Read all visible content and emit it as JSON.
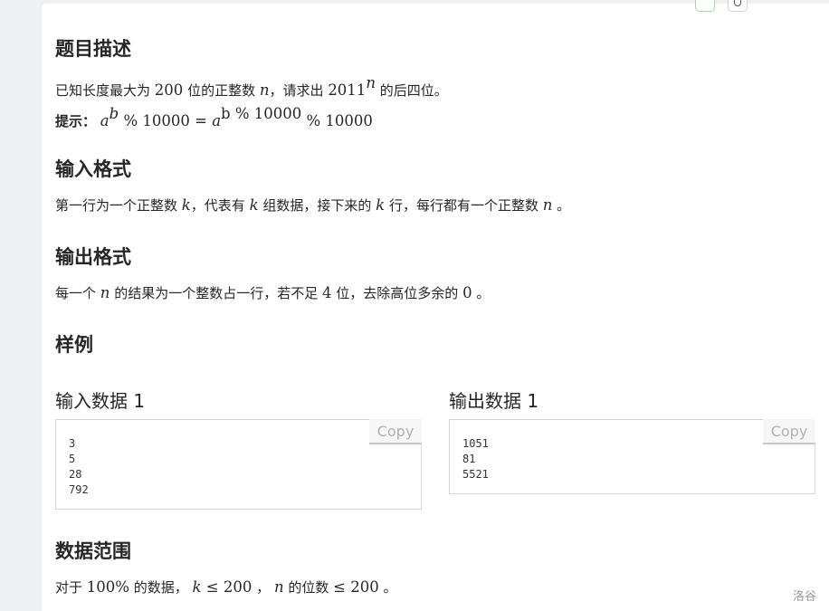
{
  "sections": {
    "description_title": "题目描述",
    "input_title": "输入格式",
    "output_title": "输出格式",
    "sample_title": "样例",
    "range_title": "数据范围"
  },
  "description": {
    "p1_a": "已知长度最大为",
    "p1_num": "200",
    "p1_b": "位的正整数",
    "p1_var": "n",
    "p1_c": "，请求出",
    "p1_base": "2011",
    "p1_exp": "n",
    "p1_d": "的后四位。",
    "hint_label": "提示：",
    "hint_a": "a",
    "hint_b": "b",
    "hint_mid": " % 10000 = ",
    "hint_a2": "a",
    "hint_exp2": "b % 10000",
    "hint_tail": " % 10000"
  },
  "input_format": {
    "a": "第一行为一个正整数",
    "k1": "k",
    "b": "，代表有",
    "k2": "k",
    "c": "组数据，接下来的",
    "k3": "k",
    "d": "行，每行都有一个正整数",
    "n": "n",
    "e": "。"
  },
  "output_format": {
    "a": "每一个",
    "n": "n",
    "b": "的结果为一个整数占一行，若不足",
    "num": "4",
    "c": "位，去除高位多余的",
    "zero": "0",
    "d": "。"
  },
  "samples": {
    "input_title": "输入数据 1",
    "output_title": "输出数据 1",
    "input_text": "3\n5\n28\n792",
    "output_text": "1051\n81\n5521",
    "copy_label": "Copy"
  },
  "range": {
    "a": "对于",
    "pct": "100%",
    "b": "的数据，",
    "k": "k",
    "le1": " ≤ 200",
    "c": "，",
    "n": "n",
    "d": "的位数",
    "le2": "≤ 200",
    "e": "。"
  },
  "footer": {
    "brand": "洛谷"
  }
}
